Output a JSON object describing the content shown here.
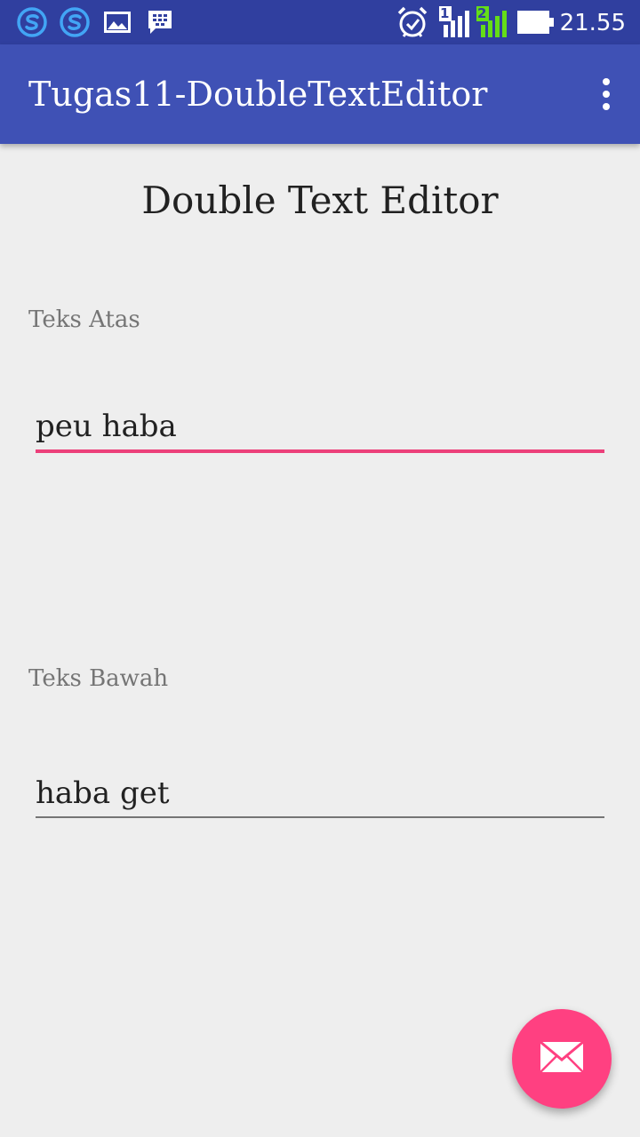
{
  "status_bar": {
    "time": "21.55",
    "sim1_badge": "1",
    "sim2_badge": "2",
    "icons": [
      "skype-icon",
      "skype-icon",
      "gallery-icon",
      "bbm-icon",
      "alarm-icon",
      "signal-sim1-icon",
      "signal-sim2-icon",
      "battery-icon"
    ],
    "colors": {
      "background": "#303f9f",
      "skype": "#42a5f5",
      "sim2_signal": "#64dd17"
    }
  },
  "app_bar": {
    "title": "Tugas11-DoubleTextEditor",
    "menu_icon": "more-vert-icon",
    "color": "#3f51b5"
  },
  "main": {
    "title": "Double Text Editor",
    "top_field": {
      "label": "Teks Atas",
      "value": "peu haba",
      "focused": true
    },
    "bottom_field": {
      "label": "Teks Bawah",
      "value": "haba get",
      "focused": false
    }
  },
  "fab": {
    "icon": "email-icon",
    "color": "#ff4081"
  }
}
